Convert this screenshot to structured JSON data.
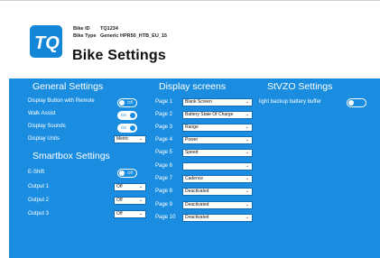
{
  "header": {
    "bike_id_label": "Bike ID",
    "bike_id_value": "TQ1234",
    "bike_type_label": "Bike Type",
    "bike_type_value": "Generic HPR50_HTB_EU_15",
    "title": "Bike Settings"
  },
  "general": {
    "title": "General Settings",
    "display_button_label": "Display Button with Remote",
    "display_button_state": "Off",
    "walk_assist_label": "Walk Assist",
    "walk_assist_state": "On",
    "display_sounds_label": "Display Sounds",
    "display_sounds_state": "On",
    "display_units_label": "Display Units",
    "display_units_value": "Metric"
  },
  "smartbox": {
    "title": "Smartbox Settings",
    "eshift_label": "E-Shift",
    "eshift_state": "Off",
    "outputs": [
      {
        "label": "Output 1",
        "value": "Off"
      },
      {
        "label": "Output 2",
        "value": "Off"
      },
      {
        "label": "Output 3",
        "value": "Off"
      }
    ]
  },
  "display": {
    "title": "Display screens",
    "pages": [
      {
        "label": "Page 1",
        "value": "Blank Screen"
      },
      {
        "label": "Page 2",
        "value": "Battery State Of Charge"
      },
      {
        "label": "Page 3",
        "value": "Range"
      },
      {
        "label": "Page 4",
        "value": "Power"
      },
      {
        "label": "Page 5",
        "value": "Speed"
      },
      {
        "label": "Page 6",
        "value": ""
      },
      {
        "label": "Page 7",
        "value": "Cadence"
      },
      {
        "label": "Page 8",
        "value": "Deactivated"
      },
      {
        "label": "Page 9",
        "value": "Deactivated"
      },
      {
        "label": "Page 10",
        "value": "Deactivated"
      }
    ]
  },
  "stvzo": {
    "title": "StVZO Settings",
    "light_backup_label": "light backup battery buffer",
    "light_backup_state": ""
  },
  "colors": {
    "panel": "#1a8de0",
    "logo": "#1386d8"
  },
  "icons": {
    "logo": "tq-logo",
    "dropdown": "chevron-down-icon"
  }
}
